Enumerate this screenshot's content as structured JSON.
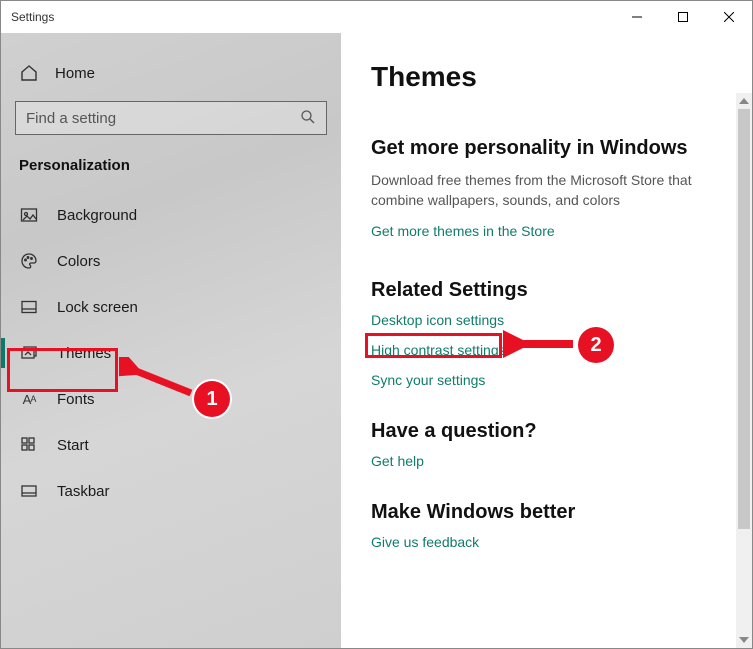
{
  "window": {
    "title": "Settings"
  },
  "sidebar": {
    "home_label": "Home",
    "search_placeholder": "Find a setting",
    "category_label": "Personalization",
    "items": [
      {
        "label": "Background"
      },
      {
        "label": "Colors"
      },
      {
        "label": "Lock screen"
      },
      {
        "label": "Themes"
      },
      {
        "label": "Fonts"
      },
      {
        "label": "Start"
      },
      {
        "label": "Taskbar"
      }
    ]
  },
  "main": {
    "title": "Themes",
    "store": {
      "heading": "Get more personality in Windows",
      "description": "Download free themes from the Microsoft Store that combine wallpapers, sounds, and colors",
      "link": "Get more themes in the Store"
    },
    "related": {
      "heading": "Related Settings",
      "links": [
        "Desktop icon settings",
        "High contrast settings",
        "Sync your settings"
      ]
    },
    "question": {
      "heading": "Have a question?",
      "link": "Get help"
    },
    "feedback": {
      "heading": "Make Windows better",
      "link": "Give us feedback"
    }
  },
  "annotations": {
    "badge1": "1",
    "badge2": "2"
  }
}
